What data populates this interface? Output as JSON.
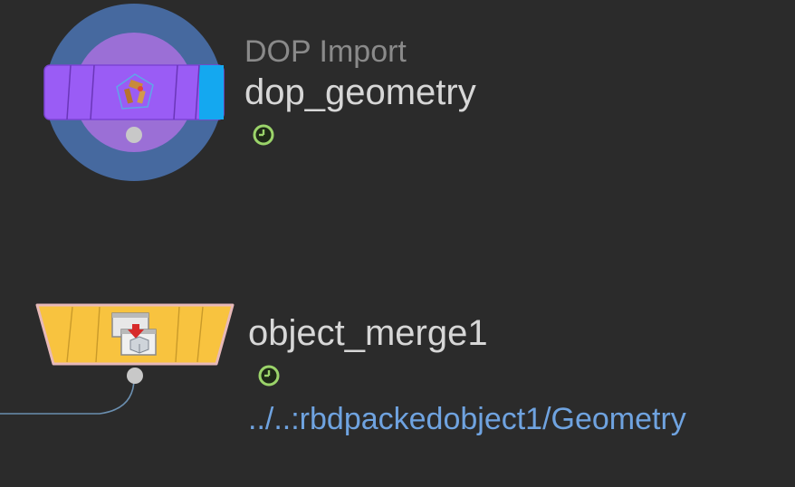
{
  "network": {
    "nodes": [
      {
        "id": "dop_geometry",
        "type_label": "DOP Import",
        "name": "dop_geometry",
        "icon": "dop-import-icon",
        "flag_icon": "time-dependent-clock-icon"
      },
      {
        "id": "object_merge1",
        "type_label": "",
        "name": "object_merge1",
        "icon": "object-merge-icon",
        "flag_icon": "time-dependent-clock-icon",
        "path": "../..:rbdpackedobject1/Geometry"
      }
    ],
    "colors": {
      "background": "#2b2b2b",
      "dop_outer_ring": "#46699f",
      "dop_inner_disc": "#9b6fd6",
      "dop_band": "#9a5cf5",
      "dop_band_end": "#14a8f0",
      "merge_body": "#f8c33f",
      "merge_outline": "#e7b9b8",
      "clock_green": "#9bd46a",
      "wire": "#6b8fb0",
      "path_text": "#6fa3e0"
    }
  }
}
